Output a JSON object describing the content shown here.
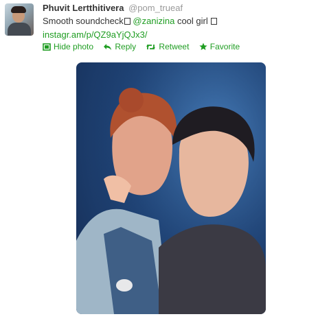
{
  "tweet": {
    "fullname": "Phuvit Lertthitivera",
    "username": "@pom_trueaf",
    "text_before": "Smooth soundcheck",
    "mention": "@zanizina",
    "text_after": " cool girl ",
    "link": "instagr.am/p/QZ9aYjQJx3/"
  },
  "actions": {
    "hide_photo": "Hide photo",
    "reply": "Reply",
    "retweet": "Retweet",
    "favorite": "Favorite"
  },
  "colors": {
    "link": "#1f9d22",
    "name": "#333333",
    "username": "#999999"
  },
  "icons": [
    "photo-icon",
    "reply-arrow-icon",
    "retweet-icon",
    "favorite-star-icon"
  ]
}
